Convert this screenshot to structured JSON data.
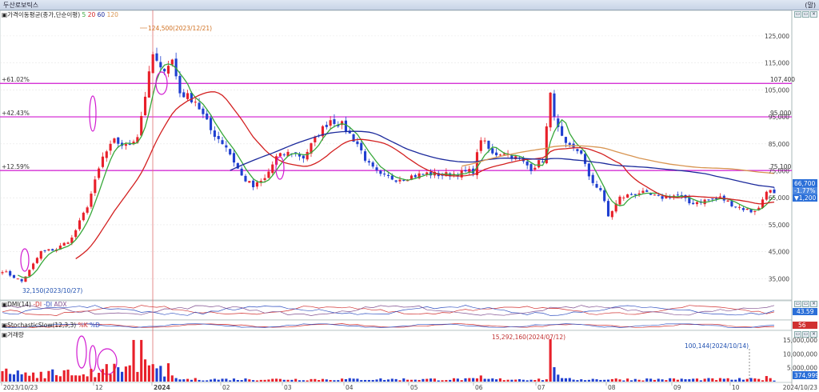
{
  "window": {
    "title": "두산로보틱스",
    "unit": "(말)"
  },
  "panels": {
    "price_legend": {
      "name": "가격이동평균(종가,단순이평)",
      "periods": [
        "5",
        "20",
        "60",
        "120"
      ]
    },
    "dmi_legend": {
      "name": "DMI(14)",
      "items": [
        "-DI",
        "-DI",
        "ADX"
      ],
      "value": "43.59"
    },
    "stoch_legend": {
      "name": "StochasticSlow(12,3,3)",
      "items": [
        "%K",
        "%D"
      ],
      "value": "56"
    },
    "volume_legend": {
      "name": "거래량"
    }
  },
  "colors": {
    "up": "#e8202a",
    "down": "#1f3fd0",
    "ma5": "#37a83a",
    "ma20": "#d32020",
    "ma60": "#1c2a9c",
    "ma120": "#d89450",
    "hline": "#d11ad1",
    "vline": "#e07070"
  },
  "annotations": {
    "high_label": "124,500(2023/12/21)",
    "low_label": "32,150(2023/10/27)",
    "vol_max_label": "15,292,160(2024/07/12)",
    "vol_recent_label": "100,144(2024/10/14)"
  },
  "horizontal_lines": [
    {
      "pct": "+61.02%",
      "value": "107,400",
      "price": 107400
    },
    {
      "pct": "+42.43%",
      "value": "95,000",
      "price": 95000
    },
    {
      "pct": "+12.59%",
      "value": "75,100",
      "price": 75100
    }
  ],
  "current": {
    "price": "66,700",
    "change_pct": "-1.77%",
    "change": "▼1,200"
  },
  "volume_current": "374,999",
  "chart_data": {
    "type": "candlestick",
    "x_labels": [
      "2023/10/23",
      "12",
      "2024",
      "02",
      "03",
      "04",
      "05",
      "06",
      "07",
      "08",
      "09",
      "10",
      "2024/10/23"
    ],
    "y_ticks": [
      35000,
      45000,
      55000,
      65000,
      75000,
      85000,
      95000,
      105000,
      115000,
      125000
    ],
    "y_tick_labels": [
      "35,000",
      "45,000",
      "55,000",
      "65,000",
      "75,000",
      "85,000",
      "95,000",
      "105,000",
      "115,000",
      "125,000"
    ],
    "ylim": [
      28000,
      130000
    ],
    "volume_ticks": [
      5000000,
      10000000,
      15000000
    ],
    "volume_tick_labels": [
      "5,000,000",
      "10,000,000",
      "15,000,000"
    ],
    "anchors": [
      {
        "i": 0,
        "p": 38000
      },
      {
        "i": 5,
        "p": 34000
      },
      {
        "i": 7,
        "p": 38000
      },
      {
        "i": 10,
        "p": 45000
      },
      {
        "i": 14,
        "p": 46000
      },
      {
        "i": 18,
        "p": 50000
      },
      {
        "i": 22,
        "p": 62000
      },
      {
        "i": 26,
        "p": 80000
      },
      {
        "i": 29,
        "p": 86000
      },
      {
        "i": 32,
        "p": 84000
      },
      {
        "i": 35,
        "p": 88000
      },
      {
        "i": 37,
        "p": 103000
      },
      {
        "i": 39,
        "p": 118000
      },
      {
        "i": 41,
        "p": 112000
      },
      {
        "i": 44,
        "p": 116000
      },
      {
        "i": 46,
        "p": 104000
      },
      {
        "i": 50,
        "p": 101000
      },
      {
        "i": 54,
        "p": 90000
      },
      {
        "i": 58,
        "p": 84000
      },
      {
        "i": 62,
        "p": 73000
      },
      {
        "i": 65,
        "p": 69000
      },
      {
        "i": 68,
        "p": 72000
      },
      {
        "i": 71,
        "p": 80000
      },
      {
        "i": 75,
        "p": 82000
      },
      {
        "i": 78,
        "p": 80000
      },
      {
        "i": 82,
        "p": 89000
      },
      {
        "i": 85,
        "p": 94000
      },
      {
        "i": 88,
        "p": 92000
      },
      {
        "i": 92,
        "p": 85000
      },
      {
        "i": 95,
        "p": 77000
      },
      {
        "i": 98,
        "p": 73000
      },
      {
        "i": 102,
        "p": 72000
      },
      {
        "i": 106,
        "p": 73000
      },
      {
        "i": 110,
        "p": 74000
      },
      {
        "i": 114,
        "p": 73500
      },
      {
        "i": 118,
        "p": 74000
      },
      {
        "i": 122,
        "p": 75000
      },
      {
        "i": 124,
        "p": 87000
      },
      {
        "i": 127,
        "p": 81000
      },
      {
        "i": 130,
        "p": 82000
      },
      {
        "i": 134,
        "p": 79000
      },
      {
        "i": 137,
        "p": 76000
      },
      {
        "i": 140,
        "p": 79000
      },
      {
        "i": 142,
        "p": 103000
      },
      {
        "i": 144,
        "p": 90000
      },
      {
        "i": 146,
        "p": 84000
      },
      {
        "i": 150,
        "p": 82000
      },
      {
        "i": 152,
        "p": 72000
      },
      {
        "i": 155,
        "p": 68000
      },
      {
        "i": 157,
        "p": 58000
      },
      {
        "i": 160,
        "p": 65000
      },
      {
        "i": 165,
        "p": 67000
      },
      {
        "i": 170,
        "p": 65000
      },
      {
        "i": 175,
        "p": 66000
      },
      {
        "i": 178,
        "p": 63000
      },
      {
        "i": 182,
        "p": 64000
      },
      {
        "i": 186,
        "p": 65000
      },
      {
        "i": 190,
        "p": 62000
      },
      {
        "i": 194,
        "p": 60000
      },
      {
        "i": 196,
        "p": 61000
      },
      {
        "i": 198,
        "p": 68000
      },
      {
        "i": 200,
        "p": 66700
      }
    ]
  }
}
